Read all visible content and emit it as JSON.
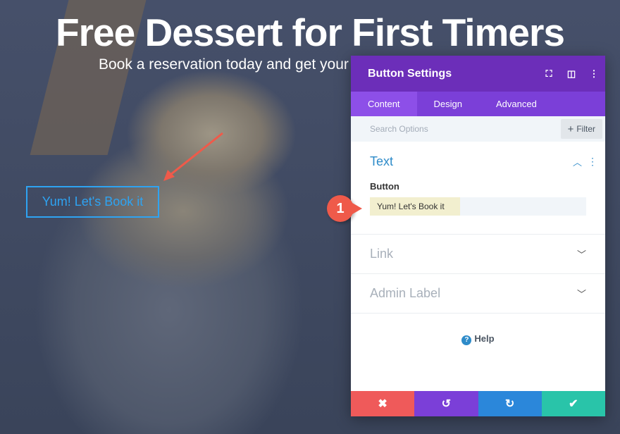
{
  "page": {
    "headline": "Free Dessert for First Timers",
    "subtitle": "Book a reservation today and get your c",
    "button_label": "Yum! Let's Book it"
  },
  "panel": {
    "title": "Button Settings",
    "icons": [
      "expand-icon",
      "sidebar-icon",
      "more-vert-icon"
    ],
    "tabs": [
      {
        "label": "Content",
        "active": true
      },
      {
        "label": "Design"
      },
      {
        "label": "Advanced"
      }
    ],
    "search_placeholder": "Search Options",
    "filter_label": "Filter",
    "sections": {
      "text": {
        "title": "Text",
        "field_label": "Button",
        "field_value": "Yum! Let's Book it"
      },
      "link": {
        "title": "Link"
      },
      "admin": {
        "title": "Admin Label"
      }
    },
    "help": "Help"
  },
  "annotation": {
    "step": "1"
  },
  "colors": {
    "header": "#6c2eb9",
    "tabs": "#7b3fd8",
    "cancel": "#ef5a5a",
    "undo": "#7b3fd8",
    "redo": "#2b87da",
    "save": "#29c4a9"
  }
}
